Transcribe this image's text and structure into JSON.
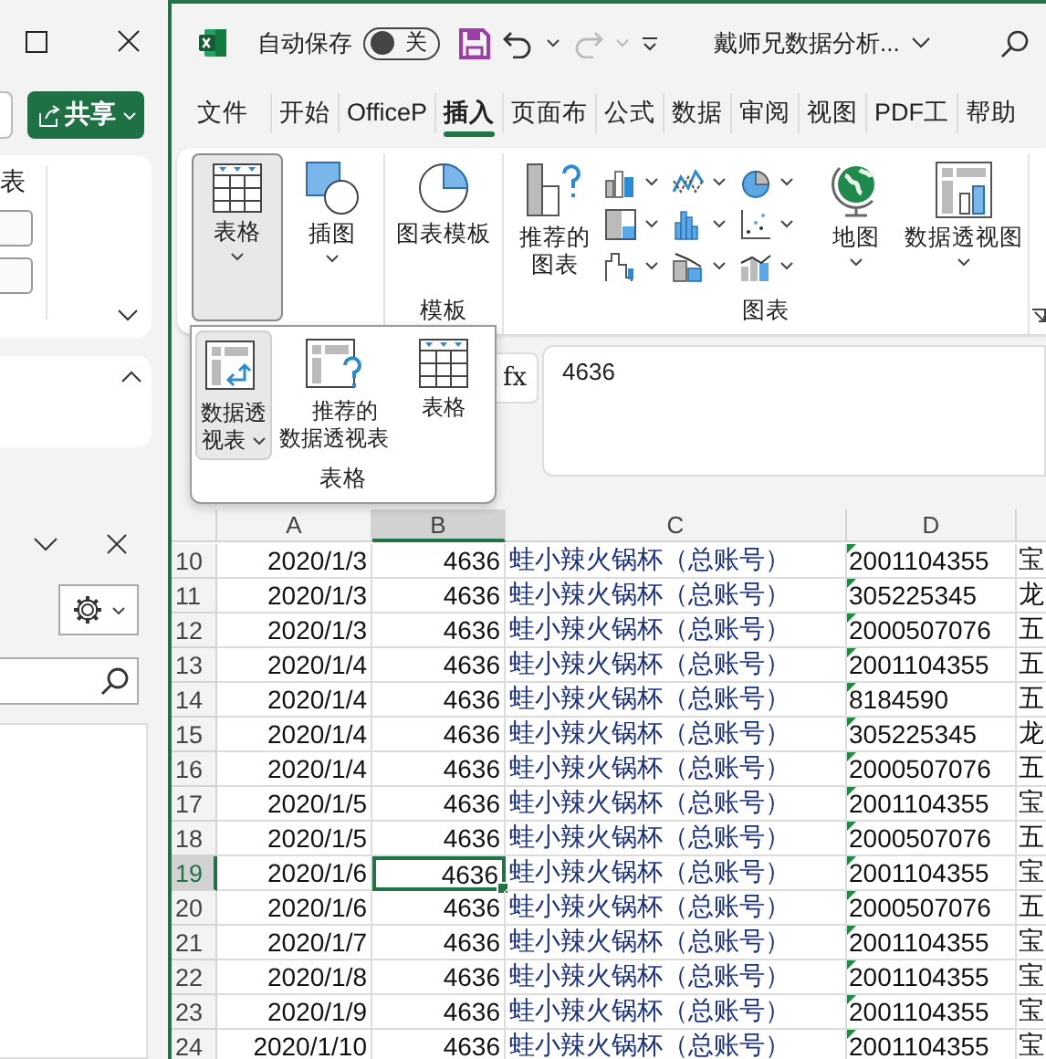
{
  "side_pane": {
    "share_button": "共享",
    "partial_label": "表"
  },
  "title_bar": {
    "autosave_label": "自动保存",
    "autosave": {
      "on": false,
      "label": "关"
    },
    "redo_disabled": true,
    "document_title": "戴师兄数据分析..."
  },
  "tabs": [
    {
      "label": "文件",
      "selected": false
    },
    {
      "label": "开始",
      "selected": false
    },
    {
      "label": "OfficeP",
      "selected": false
    },
    {
      "label": "插入",
      "selected": true
    },
    {
      "label": "页面布",
      "selected": false
    },
    {
      "label": "公式",
      "selected": false
    },
    {
      "label": "数据",
      "selected": false
    },
    {
      "label": "审阅",
      "selected": false
    },
    {
      "label": "视图",
      "selected": false
    },
    {
      "label": "PDF工",
      "selected": false
    },
    {
      "label": "帮助",
      "selected": false
    }
  ],
  "ribbon": {
    "groups": [
      {
        "buttons": [
          {
            "label": "表格",
            "selected": true,
            "menu": true
          },
          {
            "label": "插图",
            "selected": false,
            "menu": true
          }
        ]
      },
      {
        "label": "模板",
        "buttons": [
          {
            "label": "图表模板",
            "selected": false,
            "menu": false
          }
        ]
      },
      {
        "label": "图表",
        "buttons": [
          {
            "label": "推荐的图表",
            "selected": false,
            "menu": false
          },
          {
            "label": "地图",
            "selected": false,
            "menu": true
          },
          {
            "label": "数据透视图",
            "selected": false,
            "menu": true
          }
        ]
      }
    ]
  },
  "table_menu": {
    "label": "表格",
    "items": [
      {
        "label": "数据透视表",
        "selected": true,
        "menu": true
      },
      {
        "label": "推荐的数据透视表",
        "selected": false,
        "menu": false
      },
      {
        "label": "表格",
        "selected": false,
        "menu": false
      }
    ]
  },
  "formula_bar": {
    "function_label": "fx",
    "value": "4636"
  },
  "sheet": {
    "columns": [
      {
        "label": "A",
        "selected": false
      },
      {
        "label": "B",
        "selected": true
      },
      {
        "label": "C",
        "selected": false
      },
      {
        "label": "D",
        "selected": false
      }
    ],
    "rows": [
      {
        "number": "10",
        "selected": false,
        "cells": [
          "2020/1/3",
          "4636",
          "蛙小辣火锅杯（总账号）",
          "2001104355",
          "宝"
        ]
      },
      {
        "number": "11",
        "selected": false,
        "cells": [
          "2020/1/3",
          "4636",
          "蛙小辣火锅杯（总账号）",
          "305225345",
          "龙"
        ]
      },
      {
        "number": "12",
        "selected": false,
        "cells": [
          "2020/1/3",
          "4636",
          "蛙小辣火锅杯（总账号）",
          "2000507076",
          "五"
        ]
      },
      {
        "number": "13",
        "selected": false,
        "cells": [
          "2020/1/4",
          "4636",
          "蛙小辣火锅杯（总账号）",
          "2001104355",
          "五"
        ]
      },
      {
        "number": "14",
        "selected": false,
        "cells": [
          "2020/1/4",
          "4636",
          "蛙小辣火锅杯（总账号）",
          "8184590",
          "五"
        ]
      },
      {
        "number": "15",
        "selected": false,
        "cells": [
          "2020/1/4",
          "4636",
          "蛙小辣火锅杯（总账号）",
          "305225345",
          "龙"
        ]
      },
      {
        "number": "16",
        "selected": false,
        "cells": [
          "2020/1/4",
          "4636",
          "蛙小辣火锅杯（总账号）",
          "2000507076",
          "五"
        ]
      },
      {
        "number": "17",
        "selected": false,
        "cells": [
          "2020/1/5",
          "4636",
          "蛙小辣火锅杯（总账号）",
          "2001104355",
          "宝"
        ]
      },
      {
        "number": "18",
        "selected": false,
        "cells": [
          "2020/1/5",
          "4636",
          "蛙小辣火锅杯（总账号）",
          "2000507076",
          "五"
        ]
      },
      {
        "number": "19",
        "selected": true,
        "cells": [
          "2020/1/6",
          "4636",
          "蛙小辣火锅杯（总账号）",
          "2001104355",
          "宝"
        ]
      },
      {
        "number": "20",
        "selected": false,
        "cells": [
          "2020/1/6",
          "4636",
          "蛙小辣火锅杯（总账号）",
          "2000507076",
          "五"
        ]
      },
      {
        "number": "21",
        "selected": false,
        "cells": [
          "2020/1/7",
          "4636",
          "蛙小辣火锅杯（总账号）",
          "2001104355",
          "宝"
        ]
      },
      {
        "number": "22",
        "selected": false,
        "cells": [
          "2020/1/8",
          "4636",
          "蛙小辣火锅杯（总账号）",
          "2001104355",
          "宝"
        ]
      },
      {
        "number": "23",
        "selected": false,
        "cells": [
          "2020/1/9",
          "4636",
          "蛙小辣火锅杯（总账号）",
          "2001104355",
          "宝"
        ]
      },
      {
        "number": "24",
        "selected": false,
        "cells": [
          "2020/1/10",
          "4636",
          "蛙小辣火锅杯（总账号）",
          "2001104355",
          "宝"
        ]
      }
    ]
  }
}
